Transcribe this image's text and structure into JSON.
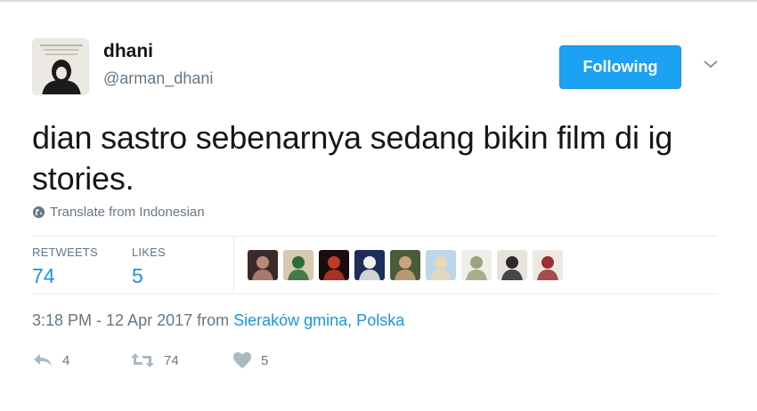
{
  "user": {
    "display_name": "dhani",
    "handle": "@arman_dhani",
    "follow_label": "Following"
  },
  "tweet": {
    "text": "dian sastro sebenarnya sedang bikin film di ig stories.",
    "translate_label": "Translate from Indonesian"
  },
  "stats": {
    "retweets_label": "RETWEETS",
    "retweets_value": "74",
    "likes_label": "LIKES",
    "likes_value": "5"
  },
  "likers": [
    {
      "color": "#3a2a2a",
      "accent": "#b88a7a"
    },
    {
      "color": "#d7c9b0",
      "accent": "#2e6b3a"
    },
    {
      "color": "#1a0d0d",
      "accent": "#c0392b"
    },
    {
      "color": "#1f2d5a",
      "accent": "#f1f1e8"
    },
    {
      "color": "#4a5b3a",
      "accent": "#c9a27e"
    },
    {
      "color": "#bcd7ea",
      "accent": "#e9d8b5"
    },
    {
      "color": "#f0eee8",
      "accent": "#9aa37c"
    },
    {
      "color": "#e8e3da",
      "accent": "#2b2b2b"
    },
    {
      "color": "#efe8e2",
      "accent": "#9c2f2f"
    }
  ],
  "meta": {
    "time_date": "3:18 PM - 12 Apr 2017 from ",
    "location": "Sieraków gmina, Polska"
  },
  "actions": {
    "reply_count": "4",
    "retweet_count": "74",
    "like_count": "5"
  },
  "colors": {
    "accent": "#1da1f2",
    "link": "#1b95e0",
    "muted": "#657786",
    "action_icon": "#aab8c2"
  }
}
